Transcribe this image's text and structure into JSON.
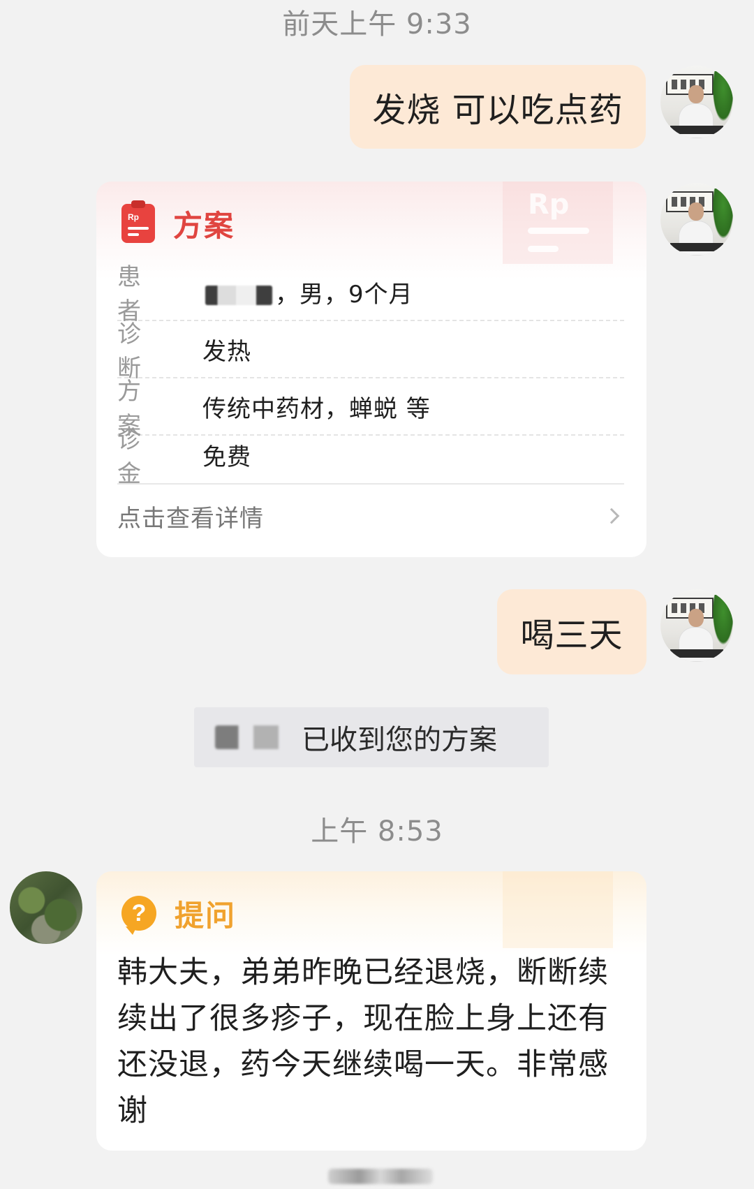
{
  "chat": {
    "timestamp_1": "前天上午 9:33",
    "msg_1": "发烧 可以吃点药",
    "prescription_card": {
      "title": "方案",
      "icon_text": "Rp",
      "rows": [
        {
          "label": "患者",
          "value_suffix": "，男，9个月"
        },
        {
          "label": "诊断",
          "value": "发热"
        },
        {
          "label": "方案",
          "value": "传统中药材，蝉蜕 等"
        },
        {
          "label": "诊金",
          "value": "免费"
        }
      ],
      "detail_link": "点击查看详情"
    },
    "msg_2": "喝三天",
    "system_notice_suffix": "已收到您的方案",
    "timestamp_2": "上午 8:53",
    "question_card": {
      "title": "提问",
      "icon_glyph": "?",
      "text": "韩大夫，弟弟昨晚已经退烧，断断续续出了很多疹子，现在脸上身上还有还没退，药今天继续喝一天。非常感谢"
    }
  }
}
